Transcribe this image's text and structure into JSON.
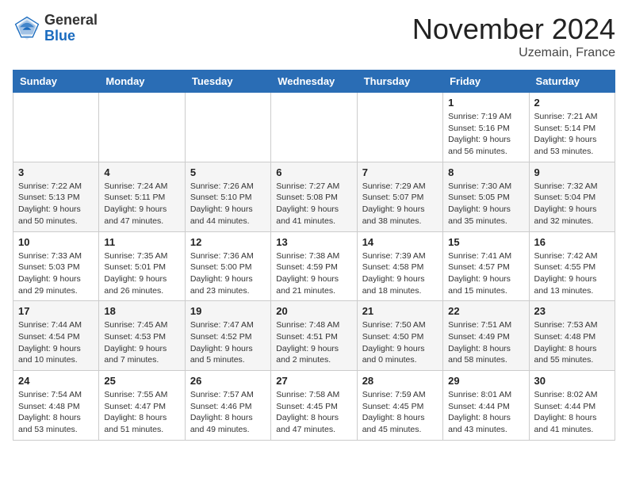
{
  "header": {
    "logo_line1": "General",
    "logo_line2": "Blue",
    "month_year": "November 2024",
    "location": "Uzemain, France"
  },
  "weekdays": [
    "Sunday",
    "Monday",
    "Tuesday",
    "Wednesday",
    "Thursday",
    "Friday",
    "Saturday"
  ],
  "rows": [
    {
      "alt": false,
      "cells": [
        {
          "day": "",
          "info": ""
        },
        {
          "day": "",
          "info": ""
        },
        {
          "day": "",
          "info": ""
        },
        {
          "day": "",
          "info": ""
        },
        {
          "day": "",
          "info": ""
        },
        {
          "day": "1",
          "info": "Sunrise: 7:19 AM\nSunset: 5:16 PM\nDaylight: 9 hours\nand 56 minutes."
        },
        {
          "day": "2",
          "info": "Sunrise: 7:21 AM\nSunset: 5:14 PM\nDaylight: 9 hours\nand 53 minutes."
        }
      ]
    },
    {
      "alt": true,
      "cells": [
        {
          "day": "3",
          "info": "Sunrise: 7:22 AM\nSunset: 5:13 PM\nDaylight: 9 hours\nand 50 minutes."
        },
        {
          "day": "4",
          "info": "Sunrise: 7:24 AM\nSunset: 5:11 PM\nDaylight: 9 hours\nand 47 minutes."
        },
        {
          "day": "5",
          "info": "Sunrise: 7:26 AM\nSunset: 5:10 PM\nDaylight: 9 hours\nand 44 minutes."
        },
        {
          "day": "6",
          "info": "Sunrise: 7:27 AM\nSunset: 5:08 PM\nDaylight: 9 hours\nand 41 minutes."
        },
        {
          "day": "7",
          "info": "Sunrise: 7:29 AM\nSunset: 5:07 PM\nDaylight: 9 hours\nand 38 minutes."
        },
        {
          "day": "8",
          "info": "Sunrise: 7:30 AM\nSunset: 5:05 PM\nDaylight: 9 hours\nand 35 minutes."
        },
        {
          "day": "9",
          "info": "Sunrise: 7:32 AM\nSunset: 5:04 PM\nDaylight: 9 hours\nand 32 minutes."
        }
      ]
    },
    {
      "alt": false,
      "cells": [
        {
          "day": "10",
          "info": "Sunrise: 7:33 AM\nSunset: 5:03 PM\nDaylight: 9 hours\nand 29 minutes."
        },
        {
          "day": "11",
          "info": "Sunrise: 7:35 AM\nSunset: 5:01 PM\nDaylight: 9 hours\nand 26 minutes."
        },
        {
          "day": "12",
          "info": "Sunrise: 7:36 AM\nSunset: 5:00 PM\nDaylight: 9 hours\nand 23 minutes."
        },
        {
          "day": "13",
          "info": "Sunrise: 7:38 AM\nSunset: 4:59 PM\nDaylight: 9 hours\nand 21 minutes."
        },
        {
          "day": "14",
          "info": "Sunrise: 7:39 AM\nSunset: 4:58 PM\nDaylight: 9 hours\nand 18 minutes."
        },
        {
          "day": "15",
          "info": "Sunrise: 7:41 AM\nSunset: 4:57 PM\nDaylight: 9 hours\nand 15 minutes."
        },
        {
          "day": "16",
          "info": "Sunrise: 7:42 AM\nSunset: 4:55 PM\nDaylight: 9 hours\nand 13 minutes."
        }
      ]
    },
    {
      "alt": true,
      "cells": [
        {
          "day": "17",
          "info": "Sunrise: 7:44 AM\nSunset: 4:54 PM\nDaylight: 9 hours\nand 10 minutes."
        },
        {
          "day": "18",
          "info": "Sunrise: 7:45 AM\nSunset: 4:53 PM\nDaylight: 9 hours\nand 7 minutes."
        },
        {
          "day": "19",
          "info": "Sunrise: 7:47 AM\nSunset: 4:52 PM\nDaylight: 9 hours\nand 5 minutes."
        },
        {
          "day": "20",
          "info": "Sunrise: 7:48 AM\nSunset: 4:51 PM\nDaylight: 9 hours\nand 2 minutes."
        },
        {
          "day": "21",
          "info": "Sunrise: 7:50 AM\nSunset: 4:50 PM\nDaylight: 9 hours\nand 0 minutes."
        },
        {
          "day": "22",
          "info": "Sunrise: 7:51 AM\nSunset: 4:49 PM\nDaylight: 8 hours\nand 58 minutes."
        },
        {
          "day": "23",
          "info": "Sunrise: 7:53 AM\nSunset: 4:48 PM\nDaylight: 8 hours\nand 55 minutes."
        }
      ]
    },
    {
      "alt": false,
      "cells": [
        {
          "day": "24",
          "info": "Sunrise: 7:54 AM\nSunset: 4:48 PM\nDaylight: 8 hours\nand 53 minutes."
        },
        {
          "day": "25",
          "info": "Sunrise: 7:55 AM\nSunset: 4:47 PM\nDaylight: 8 hours\nand 51 minutes."
        },
        {
          "day": "26",
          "info": "Sunrise: 7:57 AM\nSunset: 4:46 PM\nDaylight: 8 hours\nand 49 minutes."
        },
        {
          "day": "27",
          "info": "Sunrise: 7:58 AM\nSunset: 4:45 PM\nDaylight: 8 hours\nand 47 minutes."
        },
        {
          "day": "28",
          "info": "Sunrise: 7:59 AM\nSunset: 4:45 PM\nDaylight: 8 hours\nand 45 minutes."
        },
        {
          "day": "29",
          "info": "Sunrise: 8:01 AM\nSunset: 4:44 PM\nDaylight: 8 hours\nand 43 minutes."
        },
        {
          "day": "30",
          "info": "Sunrise: 8:02 AM\nSunset: 4:44 PM\nDaylight: 8 hours\nand 41 minutes."
        }
      ]
    }
  ]
}
